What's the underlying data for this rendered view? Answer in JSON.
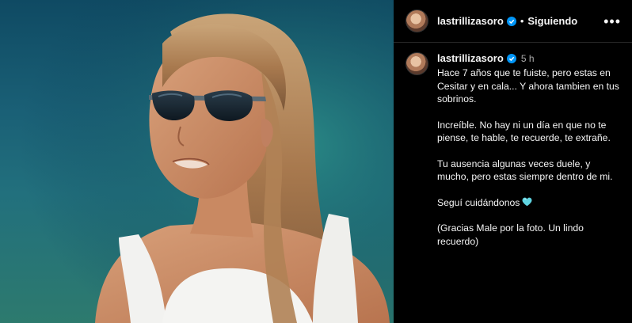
{
  "header": {
    "username": "lastrillizasoro",
    "separator": "•",
    "follow_status": "Siguiendo",
    "more_icon": "more-horizontal-icon"
  },
  "caption": {
    "username": "lastrillizasoro",
    "time": "5 h",
    "paragraphs": [
      "Hace 7 años que te fuiste, pero estas en Cesitar y en cala... Y ahora tambien en tus sobrinos.",
      "Increíble. No hay ni un día en que no te piense, te hable, te recuerde, te extrañe.",
      "Tu ausencia algunas veces duele, y mucho, pero estas siempre dentro de mi.",
      "Seguí cuidándonos",
      "(Gracias Male por la foto. Un lindo recuerdo)"
    ],
    "emoji": "turquoise-heart-icon"
  },
  "colors": {
    "background": "#000000",
    "verified_blue": "#0095f6",
    "muted_text": "#a8a8a8",
    "heart_turquoise": "#5fd3e0"
  },
  "photo": {
    "subject": "woman with sunglasses and long hair, white tank top, teal background"
  }
}
